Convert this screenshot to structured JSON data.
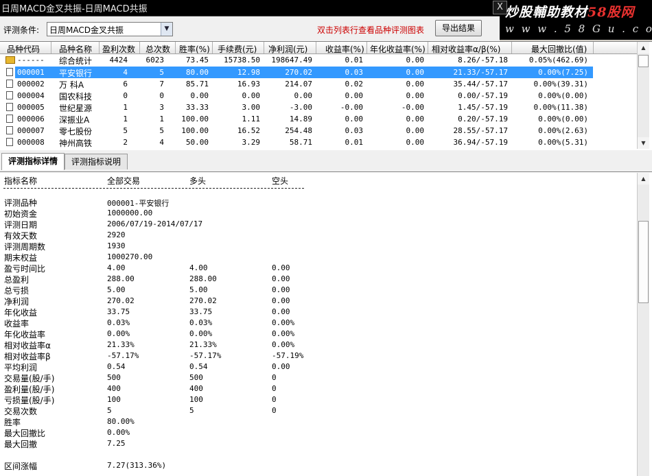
{
  "window": {
    "title": "日周MACD金叉共振-日周MACD共振",
    "close": "X"
  },
  "brand": {
    "text": "炒股輔助教材",
    "highlight": "58股网",
    "url": "w w w . 5 8 G u . c o m"
  },
  "toolbar": {
    "cond_label": "评测条件:",
    "cond_value": "日周MACD金叉共振",
    "hint": "双击列表行查看品种评测图表",
    "export_label": "导出结果"
  },
  "table": {
    "columns": [
      "品种代码",
      "品种名称",
      "盈利次数",
      "总次数",
      "胜率(%)",
      "手续费(元)",
      "净利润(元)",
      "收益率(%)",
      "年化收益率(%)",
      "相对收益率α/β(%)",
      "最大回撤比(值)"
    ],
    "rows": [
      [
        "------",
        "综合统计",
        "4424",
        "6023",
        "73.45",
        "15738.50",
        "198647.49",
        "0.01",
        "0.00",
        "8.26/-57.18",
        "0.05%(462.69)"
      ],
      [
        "000001",
        "平安银行",
        "4",
        "5",
        "80.00",
        "12.98",
        "270.02",
        "0.03",
        "0.00",
        "21.33/-57.17",
        "0.00%(7.25)"
      ],
      [
        "000002",
        "万 科A",
        "6",
        "7",
        "85.71",
        "16.93",
        "214.07",
        "0.02",
        "0.00",
        "35.44/-57.17",
        "0.00%(39.31)"
      ],
      [
        "000004",
        "国农科技",
        "0",
        "0",
        "0.00",
        "0.00",
        "0.00",
        "0.00",
        "0.00",
        "0.00/-57.19",
        "0.00%(0.00)"
      ],
      [
        "000005",
        "世纪星源",
        "1",
        "3",
        "33.33",
        "3.00",
        "-3.00",
        "-0.00",
        "-0.00",
        "1.45/-57.19",
        "0.00%(11.38)"
      ],
      [
        "000006",
        "深振业A",
        "1",
        "1",
        "100.00",
        "1.11",
        "14.89",
        "0.00",
        "0.00",
        "0.20/-57.19",
        "0.00%(0.00)"
      ],
      [
        "000007",
        "零七股份",
        "5",
        "5",
        "100.00",
        "16.52",
        "254.48",
        "0.03",
        "0.00",
        "28.55/-57.17",
        "0.00%(2.63)"
      ],
      [
        "000008",
        "神州高铁",
        "2",
        "4",
        "50.00",
        "3.29",
        "58.71",
        "0.01",
        "0.00",
        "36.94/-57.19",
        "0.00%(5.31)"
      ]
    ]
  },
  "tabs": [
    "评测指标详情",
    "评测指标说明"
  ],
  "details": {
    "headers": [
      "指标名称",
      "全部交易",
      "多头",
      "空头"
    ],
    "rows": [
      [
        "评测品种",
        "000001-平安银行",
        "",
        ""
      ],
      [
        "初始资金",
        "1000000.00",
        "",
        ""
      ],
      [
        "评测日期",
        "2006/07/19-2014/07/17",
        "",
        ""
      ],
      [
        "有效天数",
        "2920",
        "",
        ""
      ],
      [
        "评测周期数",
        "1930",
        "",
        ""
      ],
      [
        "期末权益",
        "1000270.00",
        "",
        ""
      ],
      [
        "盈亏时间比",
        "4.00",
        "4.00",
        "0.00"
      ],
      [
        "总盈利",
        "288.00",
        "288.00",
        "0.00"
      ],
      [
        "总亏损",
        "5.00",
        "5.00",
        "0.00"
      ],
      [
        "净利润",
        "270.02",
        "270.02",
        "0.00"
      ],
      [
        "年化收益",
        "33.75",
        "33.75",
        "0.00"
      ],
      [
        "收益率",
        "0.03%",
        "0.03%",
        "0.00%"
      ],
      [
        "年化收益率",
        "0.00%",
        "0.00%",
        "0.00%"
      ],
      [
        "相对收益率α",
        "21.33%",
        "21.33%",
        "0.00%"
      ],
      [
        "相对收益率β",
        "-57.17%",
        "-57.17%",
        "-57.19%"
      ],
      [
        "平均利润",
        "0.54",
        "0.54",
        "0.00"
      ],
      [
        "交易量(股/手)",
        "500",
        "500",
        "0"
      ],
      [
        "盈利量(股/手)",
        "400",
        "400",
        "0"
      ],
      [
        "亏损量(股/手)",
        "100",
        "100",
        "0"
      ],
      [
        "交易次数",
        "5",
        "5",
        "0"
      ],
      [
        "胜率",
        "80.00%",
        "",
        ""
      ],
      [
        "最大回撤比",
        "0.00%",
        "",
        ""
      ],
      [
        "最大回撤",
        "7.25",
        "",
        ""
      ],
      [
        "",
        "",
        " ",
        ""
      ],
      [
        "区间涨幅",
        "7.27(313.36%)",
        "",
        ""
      ]
    ]
  }
}
